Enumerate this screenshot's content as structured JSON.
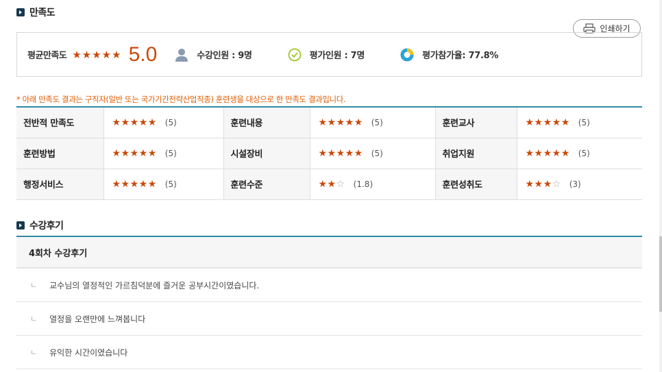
{
  "satisfaction": {
    "section_title": "만족도",
    "print_label": "인쇄하기",
    "avg_label": "평균만족도",
    "avg_stars": "★★★★★",
    "avg_score": "5.0",
    "enrolled": "수강인원 : 9명",
    "evaluated": "평가인원 : 7명",
    "participation": "평가참가율: 77.8%",
    "notice": "* 아래 만족도 결과는 구직자(일반 또는 국가기간전략산업직종) 훈련생을 대상으로 한 만족도 결과입니다.",
    "rows": [
      [
        {
          "label": "전반적 만족도",
          "stars": "★★★★★",
          "empty": "",
          "score": "(5)"
        },
        {
          "label": "훈련내용",
          "stars": "★★★★★",
          "empty": "",
          "score": "(5)"
        },
        {
          "label": "훈련교사",
          "stars": "★★★★★",
          "empty": "",
          "score": "(5)"
        }
      ],
      [
        {
          "label": "훈련방법",
          "stars": "★★★★★",
          "empty": "",
          "score": "(5)"
        },
        {
          "label": "시설장비",
          "stars": "★★★★★",
          "empty": "",
          "score": "(5)"
        },
        {
          "label": "취업지원",
          "stars": "★★★★★",
          "empty": "",
          "score": "(5)"
        }
      ],
      [
        {
          "label": "행정서비스",
          "stars": "★★★★★",
          "empty": "",
          "score": "(5)"
        },
        {
          "label": "훈련수준",
          "stars": "★★",
          "empty": "☆",
          "score": "(1.8)"
        },
        {
          "label": "훈련성취도",
          "stars": "★★★",
          "empty": "☆",
          "score": "(3)"
        }
      ]
    ],
    "colors": {
      "accent": "#c9490a",
      "line": "#2e8aa3",
      "notice": "#e05b00"
    }
  },
  "reviews": {
    "section_title": "수강후기",
    "header": "4회차 수강후기",
    "items": [
      "교수님의 열정적인 가르침덕분에 즐거운 공부시간이였습니다.",
      "열정을 오랜만에 느껴봅니다",
      "유익한 시간이였습니다"
    ],
    "item_marker": "ㄴ"
  }
}
